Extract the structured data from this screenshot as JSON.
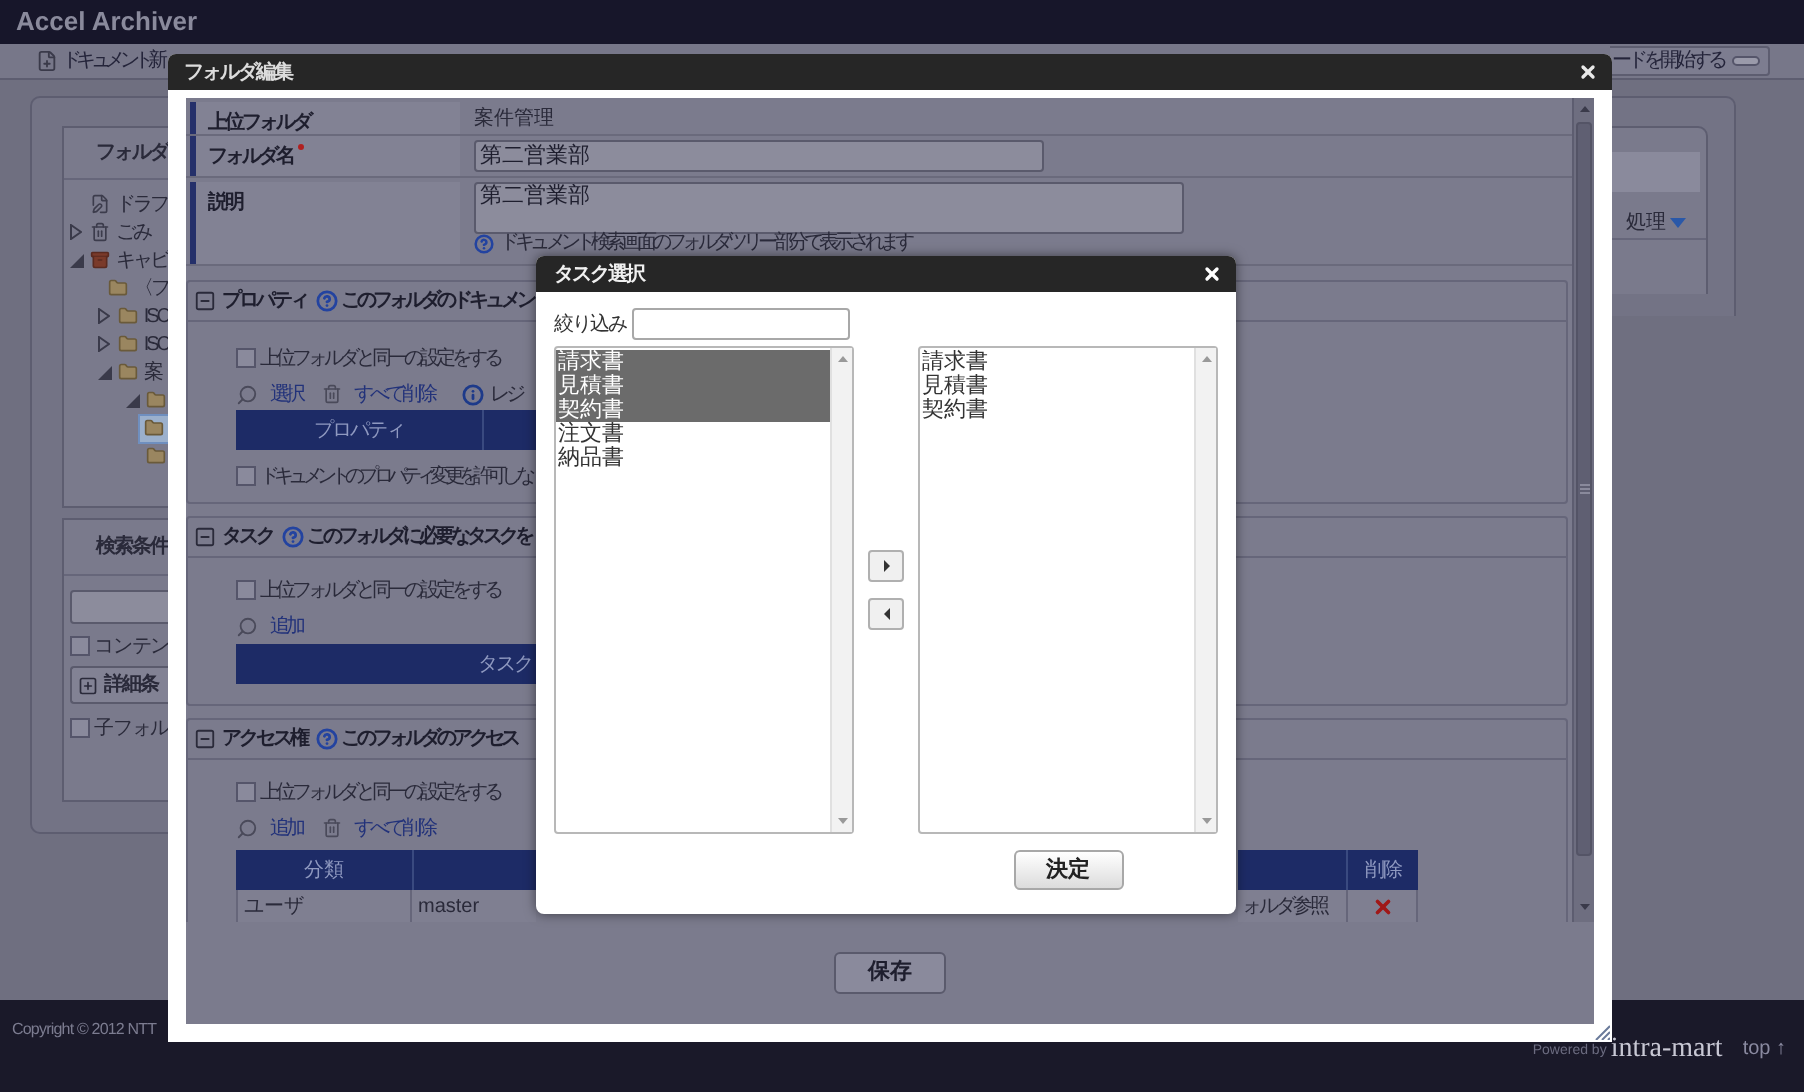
{
  "app": {
    "title": "Accel Archiver"
  },
  "toolbar": {
    "new_document": "ドキュメント新",
    "mode_button": "ードを開始する"
  },
  "folder_panel": {
    "title": "フォルダ",
    "tree": [
      {
        "kind": "draft",
        "label": "ドラフ",
        "selected": false
      },
      {
        "kind": "trash",
        "label": "ごみ",
        "expanded": false,
        "selected": false
      },
      {
        "kind": "cabinet",
        "label": "キャビ",
        "expanded": true,
        "selected": false,
        "children": [
          {
            "kind": "folder",
            "label": "〈フ",
            "selected": false
          },
          {
            "kind": "folder",
            "label": "ISC",
            "expanded": false,
            "selected": false
          },
          {
            "kind": "folder",
            "label": "ISC",
            "expanded": false,
            "selected": false
          },
          {
            "kind": "folder",
            "label": "案",
            "expanded": true,
            "selected": false,
            "children": [
              {
                "kind": "folder",
                "expanded": true,
                "selected": false,
                "children": [
                  {
                    "kind": "folder",
                    "selected": true
                  },
                  {
                    "kind": "folder",
                    "selected": false
                  }
                ]
              }
            ]
          }
        ]
      }
    ]
  },
  "search_panel": {
    "title": "検索条件",
    "content_checkbox": {
      "label": "コンテン",
      "checked": false
    },
    "detail_button": "詳細条",
    "subfolder_checkbox": {
      "label": "子フォル",
      "checked": false
    }
  },
  "right_panel": {
    "menu": "処理"
  },
  "footer": {
    "copyright": "Copyright © 2012 NTT",
    "powered_by": "Powered by",
    "brand": "intra-mart",
    "top_link": "top ↑"
  },
  "folder_dialog": {
    "title": "フォルダ編集",
    "fields": [
      {
        "kind": "text",
        "label": "上位フォルダ",
        "required": false,
        "value": "案件管理"
      },
      {
        "kind": "input",
        "label": "フォルダ名",
        "required": true,
        "value": "第二営業部"
      },
      {
        "kind": "textarea",
        "label": "説明",
        "required": false,
        "value": "第二営業部",
        "help": "ドキュメント検索画面のフォルダツリー部分で表示されます"
      }
    ],
    "sections": [
      {
        "kind": "property",
        "title": "プロパティ",
        "expanded": true,
        "help": "このフォルダのドキュメン",
        "inherit": {
          "label": "上位フォルダと同一の設定をする",
          "checked": false
        },
        "actions": [
          {
            "kind": "select",
            "label": "選択"
          },
          {
            "kind": "delete",
            "label": "すべて削除"
          },
          {
            "kind": "info",
            "label": "レジ"
          }
        ],
        "bar": "プロパティ",
        "note": {
          "label": "ドキュメントのプロパティ変更を許可しな",
          "checked": false
        }
      },
      {
        "kind": "task",
        "title": "タスク",
        "expanded": true,
        "help": "このフォルダに必要なタスクを",
        "inherit": {
          "label": "上位フォルダと同一の設定をする",
          "checked": false
        },
        "actions": [
          {
            "kind": "add",
            "label": "追加"
          }
        ],
        "bar": "タスク"
      },
      {
        "kind": "access",
        "title": "アクセス権",
        "expanded": true,
        "help": "このフォルダのアクセス",
        "inherit": {
          "label": "上位フォルダと同一の設定をする",
          "checked": false
        },
        "actions": [
          {
            "kind": "add",
            "label": "追加"
          },
          {
            "kind": "delete",
            "label": "すべて削除"
          }
        ],
        "table": {
          "columns": [
            "分類",
            "削除"
          ],
          "rows": [
            {
              "cells": [
                "ユーザ",
                "master",
                "ォルダ参照"
              ]
            }
          ]
        }
      }
    ],
    "save_button": "保存"
  },
  "task_dialog": {
    "title": "タスク選択",
    "filter_label": "絞り込み",
    "available": [
      {
        "label": "請求書",
        "selected": true
      },
      {
        "label": "見積書",
        "selected": true
      },
      {
        "label": "契約書",
        "selected": true
      },
      {
        "label": "注文書",
        "selected": false
      },
      {
        "label": "納品書",
        "selected": false
      }
    ],
    "chosen": [
      {
        "label": "請求書",
        "selected": false
      },
      {
        "label": "見積書",
        "selected": false
      },
      {
        "label": "契約書",
        "selected": false
      }
    ],
    "ok_button": "決定"
  }
}
